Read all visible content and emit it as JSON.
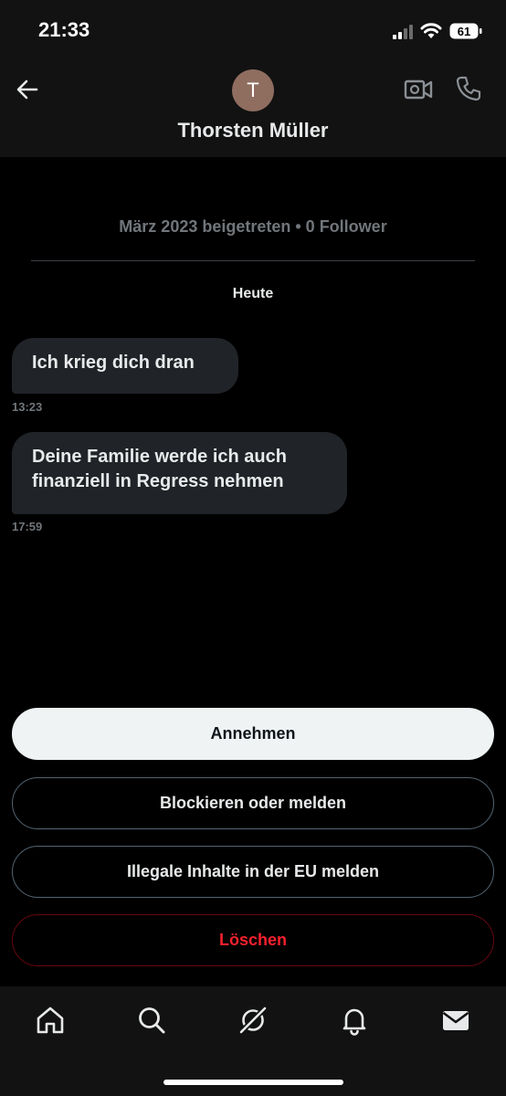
{
  "status_bar": {
    "time": "21:33",
    "battery": "61"
  },
  "header": {
    "back_icon": "arrow-left-icon",
    "avatar_initial": "T",
    "avatar_color": "#8f6e60",
    "contact_name": "Thorsten Müller",
    "video_icon": "video-camera-icon",
    "phone_icon": "phone-icon"
  },
  "conversation": {
    "join_info": "März 2023 beigetreten • 0 Follower",
    "day_label": "Heute",
    "messages": [
      {
        "text": "Ich krieg dich dran",
        "time": "13:23"
      },
      {
        "text": "Deine Familie werde ich auch finanziell in Regress nehmen",
        "time": "17:59"
      }
    ]
  },
  "actions": {
    "accept": "Annehmen",
    "block_report": "Blockieren oder melden",
    "report_illegal": "Illegale Inhalte in der EU melden",
    "delete": "Löschen"
  },
  "tab_bar": {
    "items": [
      "home-icon",
      "search-icon",
      "grok-icon",
      "notifications-bell-icon",
      "messages-envelope-icon"
    ]
  },
  "colors": {
    "background": "#000000",
    "bubble": "#202327",
    "accent_delete": "#f4212e",
    "secondary_text": "#71767b"
  }
}
